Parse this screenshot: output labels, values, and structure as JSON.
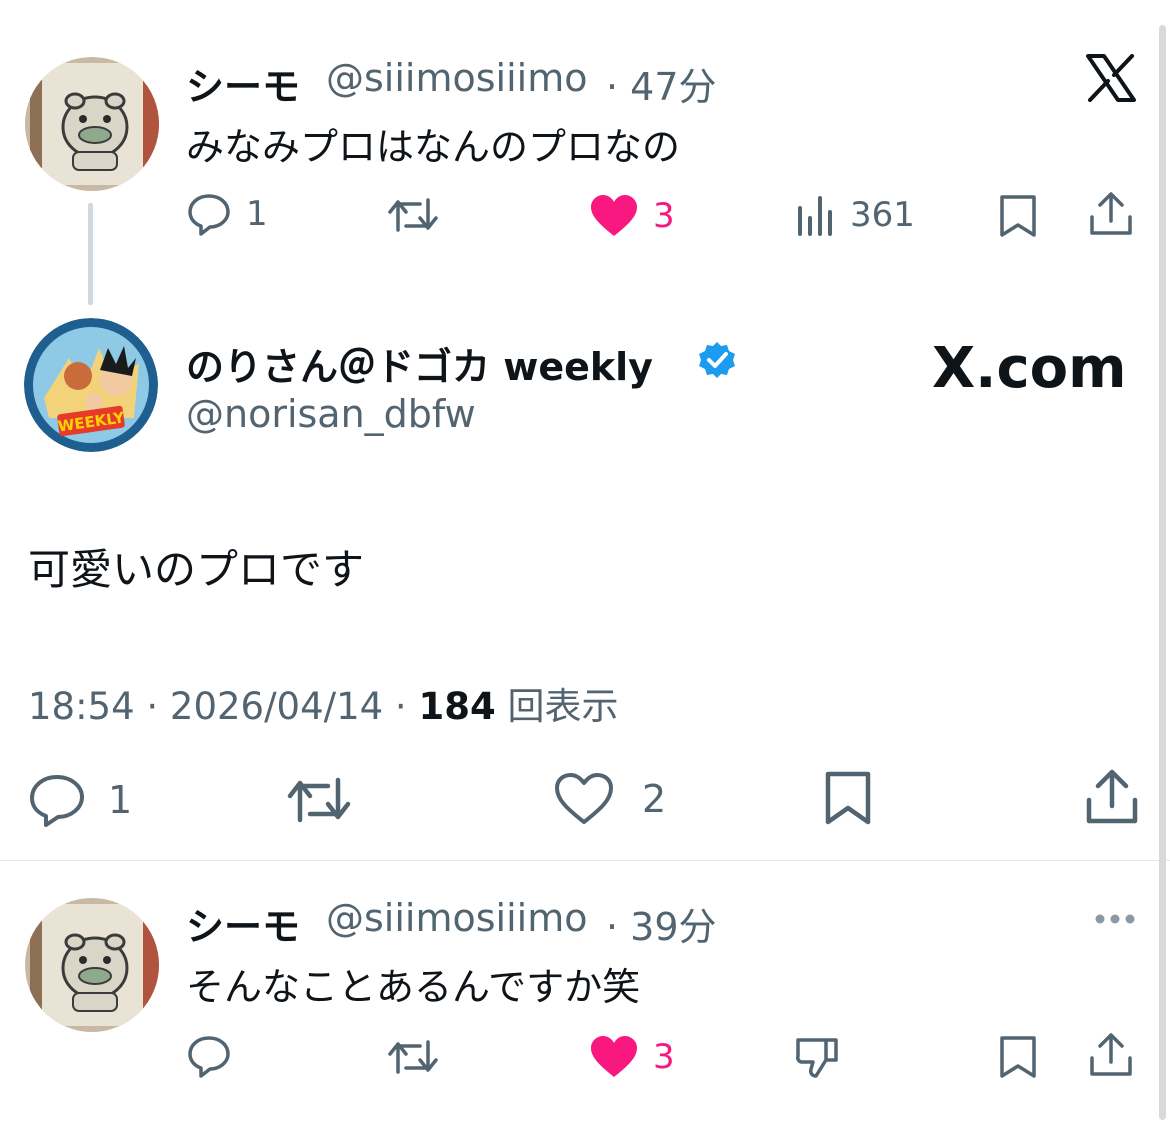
{
  "tweet1": {
    "name": "シーモ",
    "handle": "@siiimosiiimo",
    "time": "· 47分",
    "text": "みなみプロはなんのプロなの",
    "reply_count": "1",
    "like_count": "3",
    "view_count": "361"
  },
  "main": {
    "name": "のりさん＠ドゴカ weekly",
    "handle": "@norisan_dbfw",
    "site": "X.com",
    "text": "可愛いのプロです",
    "time": "18:54 · 2026/04/14 · ",
    "views": "184",
    "views_label": " 回表示",
    "reply_count": "1",
    "like_count": "2",
    "avatar_text": "WEEKLY"
  },
  "reply": {
    "name": "シーモ",
    "handle": "@siiimosiiimo",
    "time": "· 39分",
    "text": "そんなことあるんですか笑",
    "like_count": "3"
  },
  "colors": {
    "text": "#0f1419",
    "secondary": "#536471",
    "like": "#f91880",
    "verified": "#1d9bf0"
  }
}
